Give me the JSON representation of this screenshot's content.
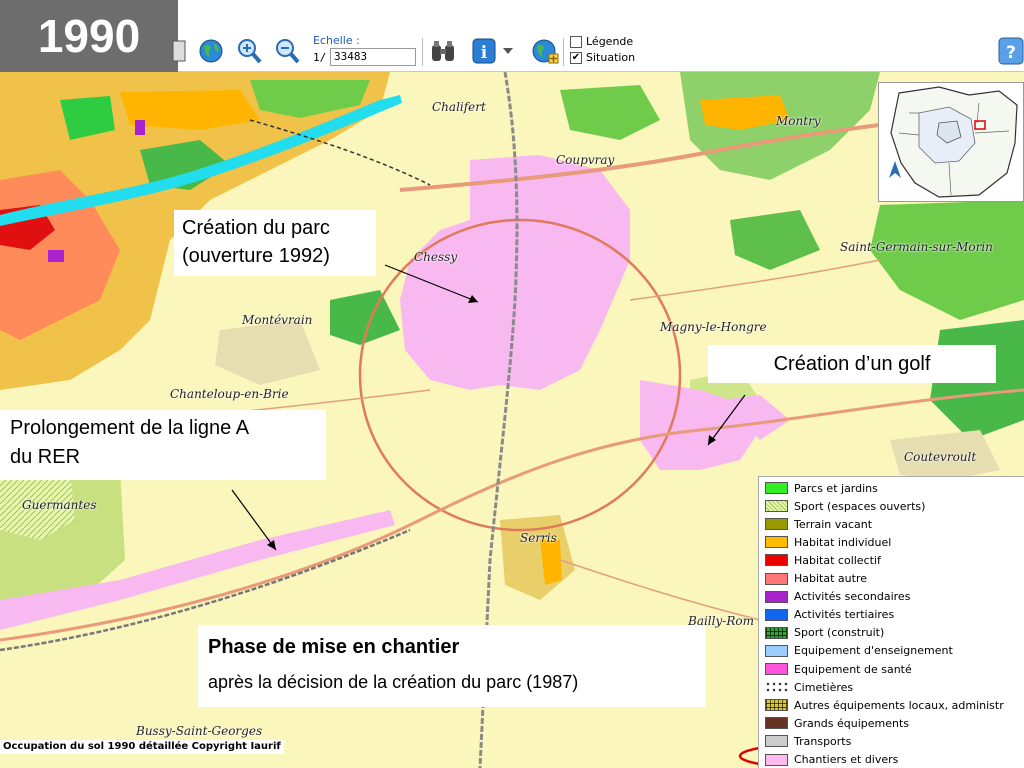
{
  "year": "1990",
  "toolbar": {
    "scale_label": "Echelle :",
    "scale_prefix": "1/",
    "scale_value": "33483",
    "legend_checkbox": {
      "label": "Légende",
      "checked": false
    },
    "situation_checkbox": {
      "label": "Situation",
      "checked": true,
      "mark": "✔"
    },
    "help_glyph": "?",
    "info_glyph": "i"
  },
  "places": [
    {
      "name": "Chalifert"
    },
    {
      "name": "Coupvray"
    },
    {
      "name": "Montry"
    },
    {
      "name": "Chessy"
    },
    {
      "name": "Saint-Germain-sur-Morin"
    },
    {
      "name": "Montévrain"
    },
    {
      "name": "Magny-le-Hongre"
    },
    {
      "name": "Chanteloup-en-Brie"
    },
    {
      "name": "Coutevroult"
    },
    {
      "name": "Guermantes"
    },
    {
      "name": "Serris"
    },
    {
      "name": "Bailly-Rom"
    },
    {
      "name": "Bussy-Saint-Georges"
    }
  ],
  "callouts": {
    "park": {
      "line1": "Création du parc",
      "line2": "(ouverture 1992)"
    },
    "golf": {
      "text": "Création d’un golf"
    },
    "rer": {
      "line1": "Prolongement de la ligne A",
      "line2": "du RER"
    },
    "phase": {
      "title": "Phase de mise en chantier",
      "text": "après la décision de la création du parc (1987)"
    }
  },
  "legend": {
    "items": [
      {
        "label": "Parcs et jardins",
        "color": "#33ee22"
      },
      {
        "label": "Sport (espaces ouverts)",
        "color": "#dff0a0",
        "pattern": "hatch"
      },
      {
        "label": "Terrain vacant",
        "color": "#999900"
      },
      {
        "label": "Habitat individuel",
        "color": "#ffbb00"
      },
      {
        "label": "Habitat collectif",
        "color": "#ee0000"
      },
      {
        "label": "Habitat autre",
        "color": "#ff7777"
      },
      {
        "label": "Activités secondaires",
        "color": "#aa22cc"
      },
      {
        "label": "Activités tertiaires",
        "color": "#1166ee"
      },
      {
        "label": "Sport (construit)",
        "color": "#116611",
        "pattern": "grid"
      },
      {
        "label": "Equipement d'enseignement",
        "color": "#99ccff"
      },
      {
        "label": "Equipement de santé",
        "color": "#ff55dd"
      },
      {
        "label": "Cimetières",
        "color": "#ffffff",
        "pattern": "cross"
      },
      {
        "label": "Autres équipements locaux, administr",
        "color": "#666600",
        "pattern": "grid"
      },
      {
        "label": "Grands équipements",
        "color": "#663322"
      },
      {
        "label": "Transports",
        "color": "#cccccc"
      },
      {
        "label": "Chantiers et divers",
        "color": "#ffbbee"
      }
    ]
  },
  "copyright": "Occupation du sol 1990 détaillée Copyright Iaurif",
  "colors": {
    "background_land": "#fbf6bb",
    "park_site": "#f8b9f0",
    "forest": "#5ec04a",
    "river": "#22ddee",
    "roads": "#e89a7a",
    "rail": "#8a8a8a",
    "highlight_ellipse": "#e00000"
  }
}
